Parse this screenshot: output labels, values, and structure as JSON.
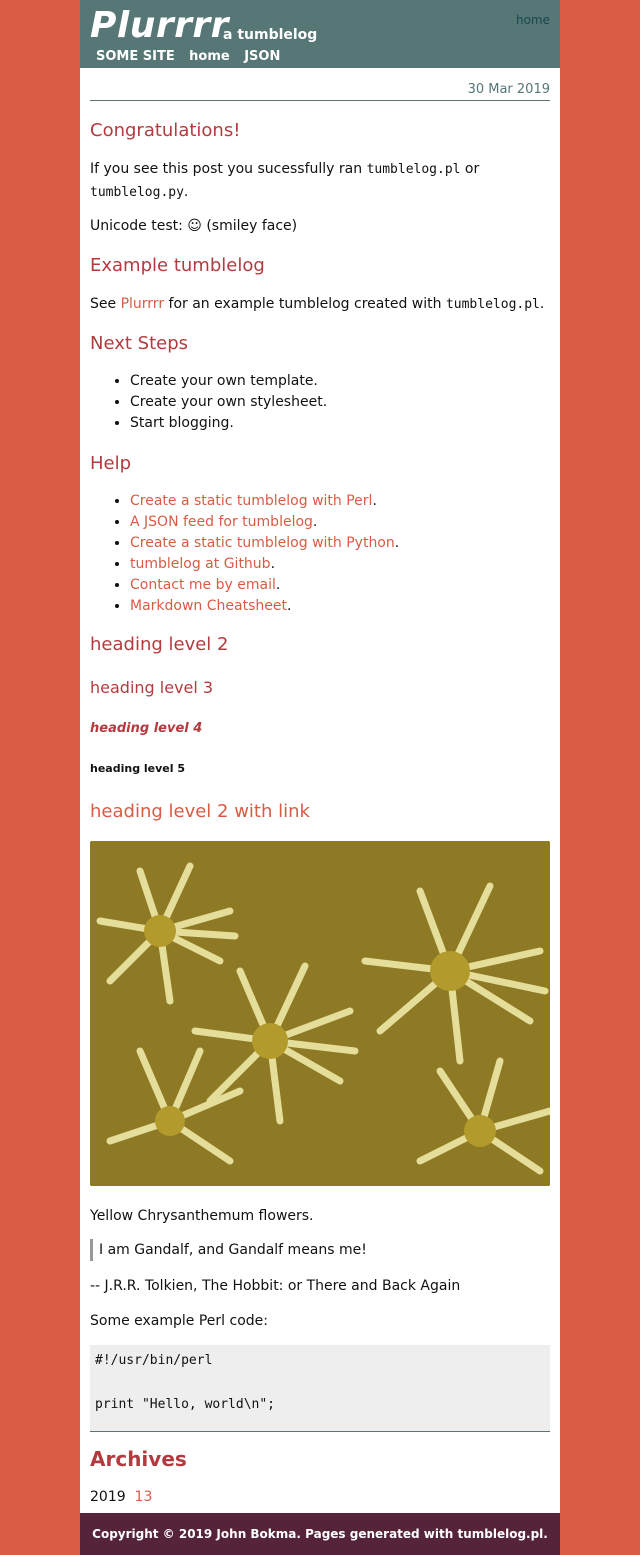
{
  "header": {
    "title": "Plurrrr",
    "tagline": "a tumblelog",
    "home_link": "home",
    "nav": [
      "SOME SITE",
      "home",
      "JSON"
    ]
  },
  "post": {
    "date": "30 Mar 2019",
    "h_congrats": "Congratulations!",
    "p1_before": "If you see this post you sucessfully ran ",
    "p1_code1": "tumblelog.pl",
    "p1_mid": " or ",
    "p1_code2": "tumblelog.py",
    "p1_end": ".",
    "unicode_test": "Unicode test: ☺ (smiley face)",
    "h_example": "Example tumblelog",
    "p2_before": "See ",
    "p2_link": "Plurrrr",
    "p2_mid": " for an example tumblelog created with ",
    "p2_code": "tumblelog.pl",
    "p2_end": ".",
    "h_next": "Next Steps",
    "next_steps": [
      "Create your own template.",
      "Create your own stylesheet.",
      "Start blogging."
    ],
    "h_help": "Help",
    "help_links": [
      "Create a static tumblelog with Perl",
      "A JSON feed for tumblelog",
      "Create a static tumblelog with Python",
      "tumblelog at Github",
      "Contact me by email",
      "Markdown Cheatsheet"
    ],
    "h2": "heading level 2",
    "h3": "heading level 3",
    "h4": "heading level 4",
    "h5": "heading level 5",
    "h2_link": "heading level 2 with link",
    "caption": "Yellow Chrysanthemum flowers.",
    "quote": "I am Gandalf, and Gandalf means me!",
    "attribution": "-- J.R.R. Tolkien, The Hobbit: or There and Back Again",
    "code_intro": "Some example Perl code:",
    "code_line1": "#!/usr/bin/perl",
    "code_line2": "print \"Hello, world\\n\";"
  },
  "archives": {
    "title": "Archives",
    "year": "2019",
    "week": "13"
  },
  "footer": {
    "text": "Copyright © 2019 John Bokma. Pages generated with tumblelog.pl."
  },
  "colors": {
    "background": "#d95b44",
    "header": "#577676",
    "heading": "#b33b3f",
    "link": "#d95b44",
    "footer": "#55233a"
  }
}
